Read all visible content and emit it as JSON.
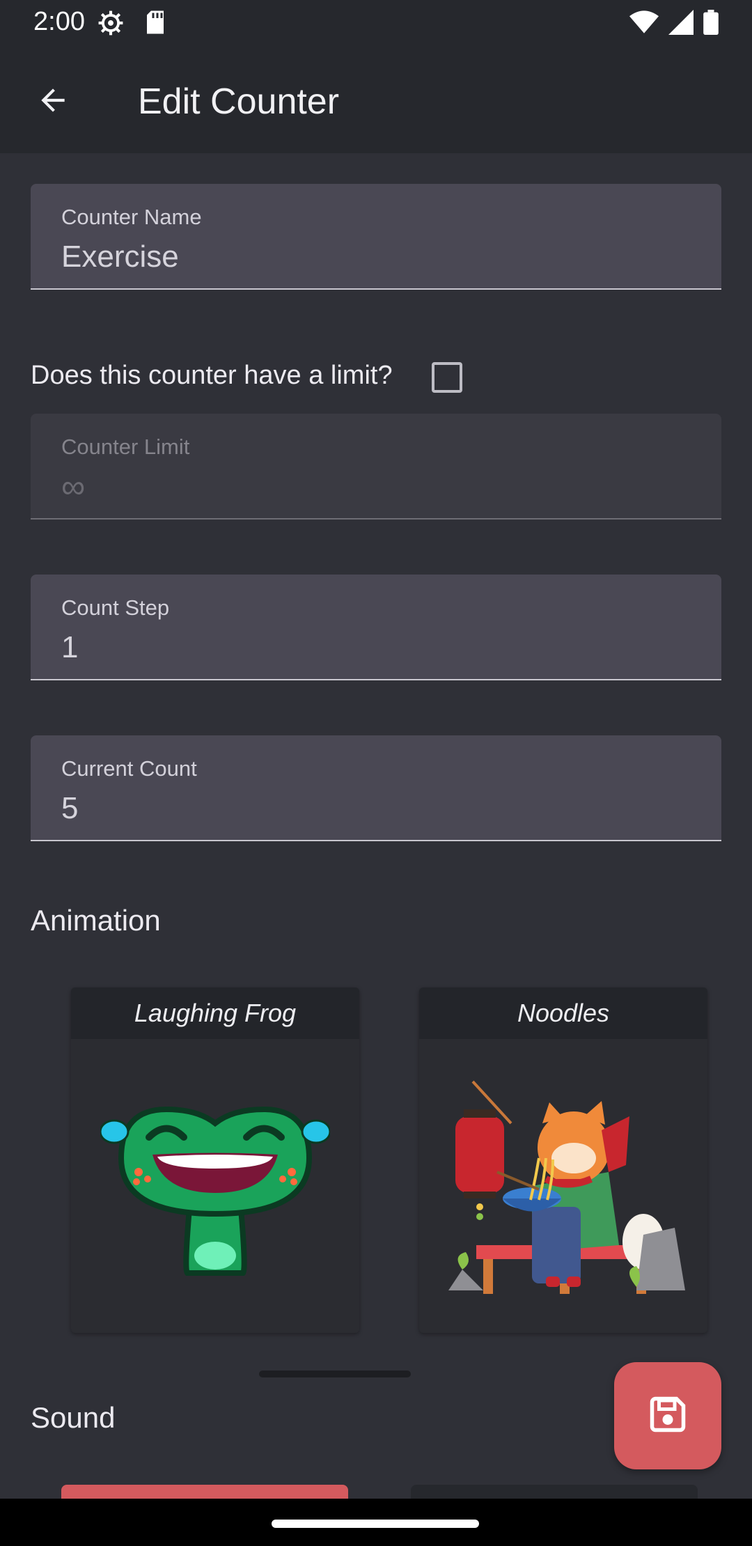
{
  "status_bar": {
    "time": "2:00",
    "icons": [
      "settings-gear-icon",
      "sd-card-icon",
      "wifi-icon",
      "signal-icon",
      "battery-icon"
    ]
  },
  "app_bar": {
    "back_icon": "arrow-back-icon",
    "title": "Edit Counter"
  },
  "form": {
    "counter_name": {
      "label": "Counter Name",
      "value": "Exercise"
    },
    "limit_question": "Does this counter have a limit?",
    "limit_checked": false,
    "counter_limit": {
      "label": "Counter Limit",
      "value": "∞"
    },
    "count_step": {
      "label": "Count Step",
      "value": "1"
    },
    "current_count": {
      "label": "Current Count",
      "value": "5"
    }
  },
  "animation": {
    "title": "Animation",
    "options": [
      {
        "name": "Laughing Frog",
        "icon": "laughing-frog-icon"
      },
      {
        "name": "Noodles",
        "icon": "shiba-eating-noodles-icon"
      }
    ]
  },
  "sound": {
    "title": "Sound"
  },
  "fab": {
    "icon": "save-icon"
  },
  "colors": {
    "background": "#2f3037",
    "appbar": "#26282d",
    "field": "#4a4854",
    "accent": "#d45a5e"
  }
}
